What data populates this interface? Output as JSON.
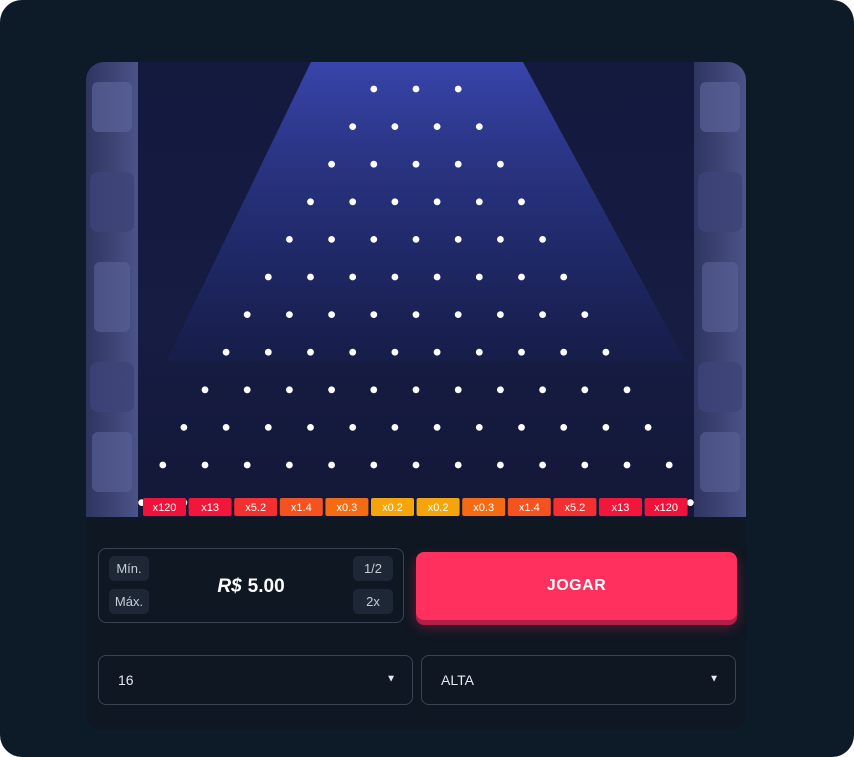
{
  "board": {
    "peg_rows": 16,
    "multipliers": [
      "x120",
      "x13",
      "x5.2",
      "x1.4",
      "x0.3",
      "x0.2",
      "x0.2",
      "x0.3",
      "x1.4",
      "x5.2",
      "x13",
      "x120"
    ],
    "multiplier_colors": [
      "#f0123b",
      "#f2163a",
      "#f3302f",
      "#f4521f",
      "#f46b13",
      "#f5a50a",
      "#f5a50a",
      "#f46b13",
      "#f4521f",
      "#f3302f",
      "#f2163a",
      "#f0123b"
    ]
  },
  "bet": {
    "min_label": "Mín.",
    "max_label": "Máx.",
    "half_label": "1/2",
    "double_label": "2x",
    "currency": "R$",
    "amount": "5.00"
  },
  "play_label": "JOGAR",
  "rows_select": {
    "value": "16"
  },
  "risk_select": {
    "value": "ALTA"
  },
  "colors": {
    "accent": "#ff2f5e",
    "background": "#0d1a27",
    "board": "#161c42"
  }
}
